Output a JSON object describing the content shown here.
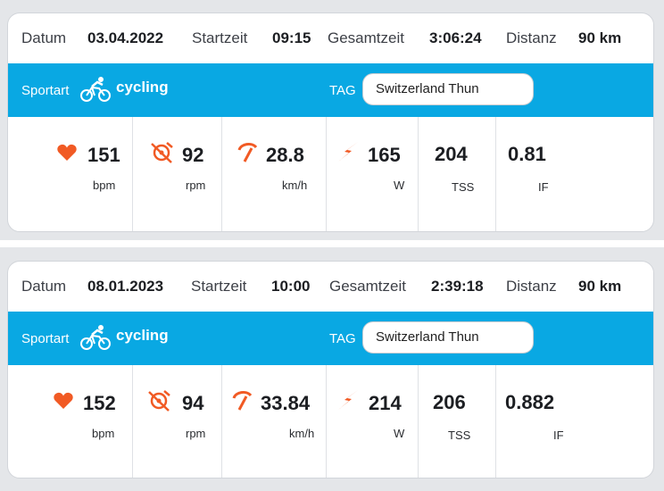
{
  "labels": {
    "datum": "Datum",
    "startzeit": "Startzeit",
    "gesamtzeit": "Gesamtzeit",
    "distanz": "Distanz",
    "sportart": "Sportart",
    "tag": "TAG"
  },
  "colors": {
    "accent": "#09a8e3",
    "icon": "#f15a24"
  },
  "icons": [
    "bike-icon",
    "heart-icon",
    "cadence-icon",
    "speed-icon",
    "power-icon"
  ],
  "activities": [
    {
      "datum": "03.04.2022",
      "startzeit": "09:15",
      "gesamtzeit": "3:06:24",
      "distanz": "90 km",
      "sport": "cycling",
      "tag": "Switzerland Thun",
      "metrics": {
        "heart_rate": {
          "value": "151",
          "unit": "bpm"
        },
        "cadence": {
          "value": "92",
          "unit": "rpm"
        },
        "speed": {
          "value": "28.8",
          "unit": "km/h"
        },
        "power": {
          "value": "165",
          "unit": "W"
        },
        "tss": {
          "value": "204",
          "unit": "TSS"
        },
        "if": {
          "value": "0.81",
          "unit": "IF"
        }
      }
    },
    {
      "datum": "08.01.2023",
      "startzeit": "10:00",
      "gesamtzeit": "2:39:18",
      "distanz": "90 km",
      "sport": "cycling",
      "tag": "Switzerland Thun",
      "metrics": {
        "heart_rate": {
          "value": "152",
          "unit": "bpm"
        },
        "cadence": {
          "value": "94",
          "unit": "rpm"
        },
        "speed": {
          "value": "33.84",
          "unit": "km/h"
        },
        "power": {
          "value": "214",
          "unit": "W"
        },
        "tss": {
          "value": "206",
          "unit": "TSS"
        },
        "if": {
          "value": "0.882",
          "unit": "IF"
        }
      }
    }
  ]
}
